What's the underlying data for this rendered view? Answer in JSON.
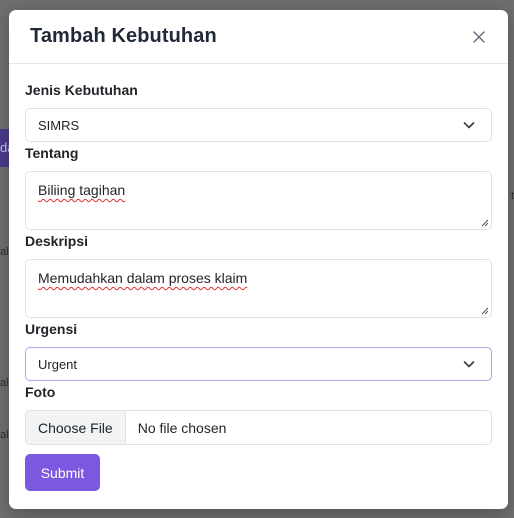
{
  "modal": {
    "title": "Tambah Kebutuhan"
  },
  "form": {
    "jenis": {
      "label": "Jenis Kebutuhan",
      "value": "SIMRS"
    },
    "tentang": {
      "label": "Tentang",
      "value": "Biliing tagihan"
    },
    "deskripsi": {
      "label": "Deskripsi",
      "value": "Memudahkan dalam proses klaim"
    },
    "urgensi": {
      "label": "Urgensi",
      "value": "Urgent"
    },
    "foto": {
      "label": "Foto",
      "button_label": "Choose File",
      "status": "No file chosen"
    },
    "submit_label": "Submit"
  },
  "background": {
    "fragments": [
      "da",
      "al",
      "al",
      "al",
      "t"
    ]
  },
  "colors": {
    "accent": "#7c57e0",
    "focus_border": "#b3a4e8",
    "backdrop": "#6e6e6e"
  },
  "icons": {
    "close": "close-icon",
    "dropdown": "chevron-down-icon",
    "resize": "resize-handle-icon"
  }
}
